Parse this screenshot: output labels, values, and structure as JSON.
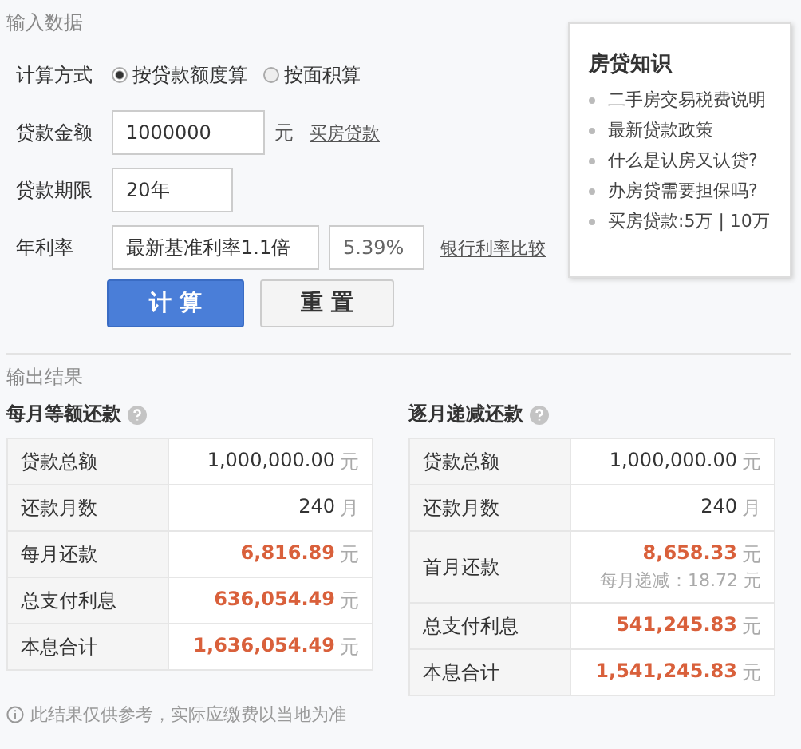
{
  "input_section": {
    "title": "输入数据",
    "method": {
      "label": "计算方式",
      "options": [
        {
          "label": "按贷款额度算",
          "selected": true
        },
        {
          "label": "按面积算",
          "selected": false
        }
      ]
    },
    "amount": {
      "label": "贷款金额",
      "value": "1000000",
      "unit": "元",
      "link": "买房贷款"
    },
    "term": {
      "label": "贷款期限",
      "value": "20年"
    },
    "rate": {
      "label": "年利率",
      "value": "最新基准利率1.1倍",
      "percent": "5.39%",
      "link": "银行利率比较"
    },
    "buttons": [
      {
        "label": "计 算",
        "kind": "primary"
      },
      {
        "label": "重 置",
        "kind": "secondary"
      }
    ]
  },
  "knowledge": {
    "title": "房贷知识",
    "items": [
      "二手房交易税费说明",
      "最新贷款政策",
      "什么是认房又认贷?",
      "办房贷需要担保吗?",
      "买房贷款:5万 | 10万"
    ]
  },
  "output_section": {
    "title": "输出结果",
    "tables": [
      {
        "title": "每月等额还款",
        "rows": [
          {
            "label": "贷款总额",
            "value": "1,000,000.00",
            "unit": "元",
            "highlight": false
          },
          {
            "label": "还款月数",
            "value": "240",
            "unit": "月",
            "highlight": false
          },
          {
            "label": "每月还款",
            "value": "6,816.89",
            "unit": "元",
            "highlight": true
          },
          {
            "label": "总支付利息",
            "value": "636,054.49",
            "unit": "元",
            "highlight": true
          },
          {
            "label": "本息合计",
            "value": "1,636,054.49",
            "unit": "元",
            "highlight": true
          }
        ]
      },
      {
        "title": "逐月递减还款",
        "rows": [
          {
            "label": "贷款总额",
            "value": "1,000,000.00",
            "unit": "元",
            "highlight": false
          },
          {
            "label": "还款月数",
            "value": "240",
            "unit": "月",
            "highlight": false
          },
          {
            "label": "首月还款",
            "value": "8,658.33",
            "unit": "元",
            "highlight": true,
            "note": "每月递减：18.72 元"
          },
          {
            "label": "总支付利息",
            "value": "541,245.83",
            "unit": "元",
            "highlight": true
          },
          {
            "label": "本息合计",
            "value": "1,541,245.83",
            "unit": "元",
            "highlight": true
          }
        ]
      }
    ],
    "disclaimer": "此结果仅供参考，实际应缴费以当地为准"
  }
}
